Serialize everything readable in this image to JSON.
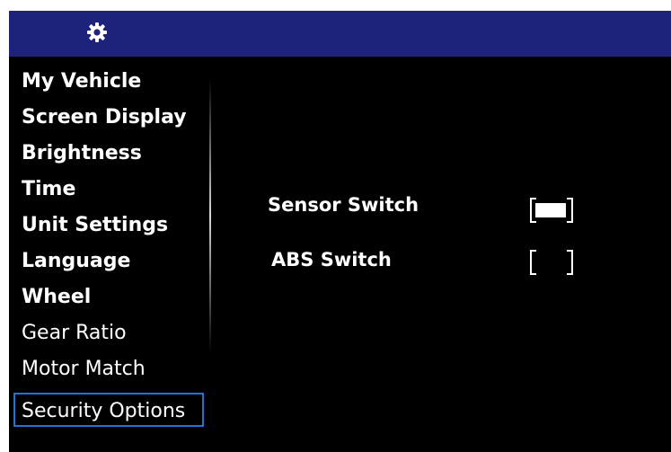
{
  "header": {
    "icon": "gear-icon",
    "background": "#1d237a"
  },
  "menu": {
    "items": [
      {
        "label": "My Vehicle"
      },
      {
        "label": "Screen Display"
      },
      {
        "label": "Brightness"
      },
      {
        "label": "Time"
      },
      {
        "label": "Unit Settings"
      },
      {
        "label": "Language"
      },
      {
        "label": "Wheel"
      },
      {
        "label": "Gear Ratio"
      },
      {
        "label": "Motor Match"
      },
      {
        "label": "Security Options",
        "selected": true
      }
    ],
    "selected_border_color": "#1f73d8"
  },
  "options": [
    {
      "label": "Sensor Switch",
      "enabled": true
    },
    {
      "label": "ABS Switch",
      "enabled": false
    }
  ]
}
